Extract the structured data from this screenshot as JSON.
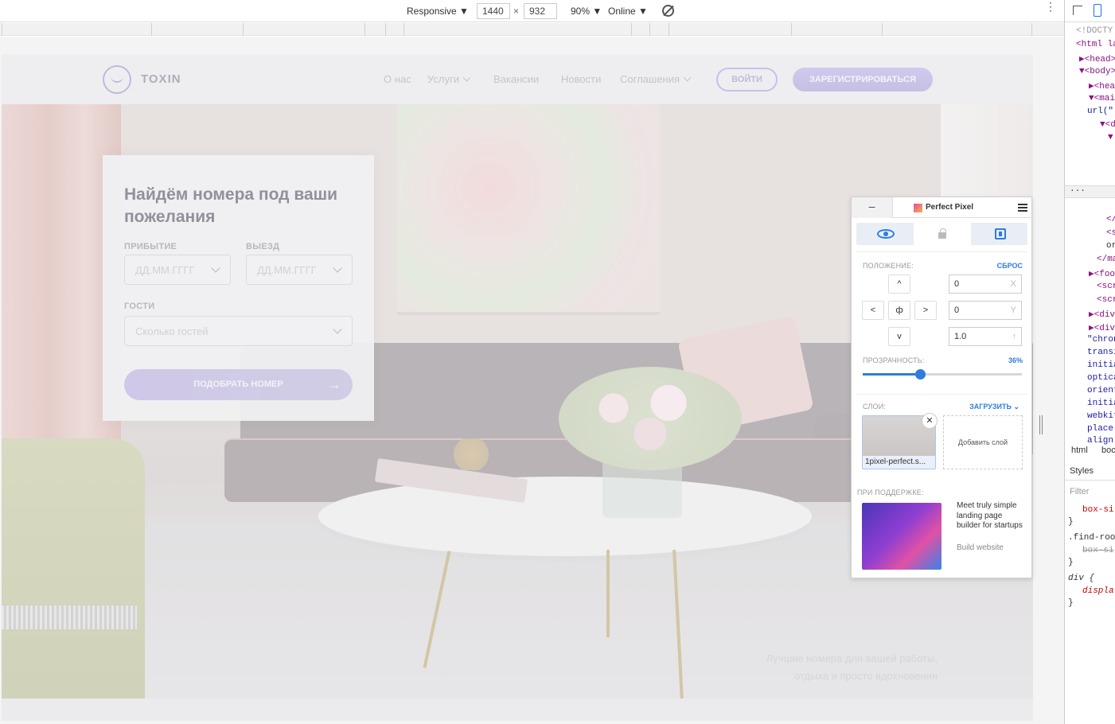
{
  "devtools_toolbar": {
    "device_label": "Responsive ▼",
    "width": "1440",
    "times": "×",
    "height": "932",
    "zoom": "90% ▼",
    "throttle": "Online ▼",
    "more": "⋮"
  },
  "site": {
    "logo_text": "TOXIN",
    "nav": [
      {
        "label": "О нас"
      },
      {
        "label": "Услуги"
      },
      {
        "label": "Вакансии"
      },
      {
        "label": "Новости"
      },
      {
        "label": "Соглашения"
      }
    ],
    "login_label": "ВОЙТИ",
    "register_label": "ЗАРЕГИСТРИРОВАТЬСЯ",
    "card": {
      "title": "Найдём номера под ваши пожелания",
      "arrival_label": "ПРИБЫТИЕ",
      "arrival_placeholder": "ДД.ММ.ГГГГ",
      "departure_label": "ВЫЕЗД",
      "departure_placeholder": "ДД.ММ.ГГГГ",
      "guests_label": "ГОСТИ",
      "guests_placeholder": "Сколько гостей",
      "submit_label": "ПОДОБРАТЬ НОМЕР",
      "submit_arrow": "→"
    },
    "tagline_line1": "Лучшие номера для вашей работы,",
    "tagline_line2": "отдыха и просто вдохновения"
  },
  "perfect_pixel": {
    "minimize": "–",
    "title": "Perfect Pixel",
    "position_label": "ПОЛОЖЕНИЕ:",
    "reset_label": "СБРОС",
    "arrow_up": "^",
    "arrow_left": "<",
    "arrow_center": "ф",
    "arrow_right": ">",
    "arrow_down": "v",
    "x_value": "0",
    "x_unit": "X",
    "y_value": "0",
    "y_unit": "Y",
    "scale_value": "1.0",
    "scale_unit": "↑",
    "opacity_label": "ПРОЗРАЧНОСТЬ:",
    "opacity_text": "36%",
    "opacity_value": 0.36,
    "layers_label": "СЛОИ:",
    "upload_label": "ЗАГРУЗИТЬ",
    "layer_name": "1pixel-perfect.s...",
    "layer_close": "✕",
    "add_layer_label": "Добавить слой",
    "sponsor_label": "ПРИ ПОДДЕРЖКЕ:",
    "sponsor_text": "Meet truly simple landing page builder for startups",
    "sponsor_link": "Build website"
  },
  "devtools_panel": {
    "elements": [
      "<!DOCTY",
      "<html la",
      "▶<head>",
      "▼<body>",
      "▶<hea",
      "▼<mai",
      "url(\"",
      "▼<d",
      "▼"
    ],
    "ellipsis": "...",
    "elements_lower": [
      "</",
      "<s",
      "or",
      "</ma",
      "▶<foo",
      "<scr",
      "<scr",
      "▶<div",
      "▶<div",
      "\"chron",
      "transi",
      "initia",
      "optica",
      "orient",
      "initia",
      "webkit",
      "place-",
      "align"
    ],
    "crumb_html": "html",
    "crumb_body": "boc",
    "styles_tab": "Styles",
    "filter_placeholder": "Filter",
    "css_lines": [
      "box-si",
      "}",
      ".find-roo",
      "box-si",
      "}",
      "div {",
      "displa",
      "}"
    ]
  },
  "colors": {
    "accent": "#9a8ec7",
    "link_blue": "#2d7de0"
  }
}
